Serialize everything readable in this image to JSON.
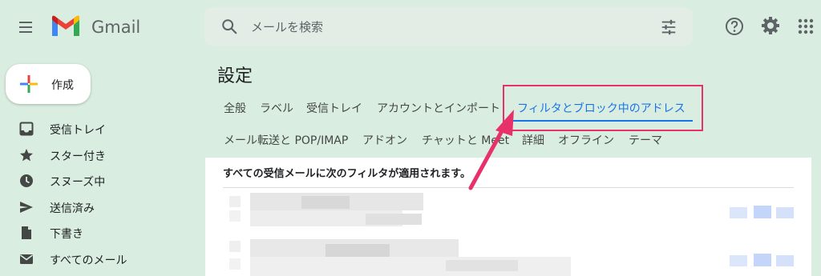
{
  "app": {
    "name": "Gmail"
  },
  "search": {
    "placeholder": "メールを検索"
  },
  "compose": {
    "label": "作成"
  },
  "sidebar": {
    "items": [
      {
        "label": "受信トレイ",
        "icon": "inbox-icon"
      },
      {
        "label": "スター付き",
        "icon": "star-icon"
      },
      {
        "label": "スヌーズ中",
        "icon": "clock-icon"
      },
      {
        "label": "送信済み",
        "icon": "send-icon"
      },
      {
        "label": "下書き",
        "icon": "draft-icon"
      },
      {
        "label": "すべてのメール",
        "icon": "mail-icon"
      }
    ]
  },
  "settings": {
    "title": "設定",
    "tabs_row1": [
      "全般",
      "ラベル",
      "受信トレイ",
      "アカウントとインポート",
      "フィルタとブロック中のアドレス"
    ],
    "tabs_row2": [
      "メール転送と POP/IMAP",
      "アドオン",
      "チャットと Meet",
      "詳細",
      "オフライン",
      "テーマ"
    ],
    "active_tab": "フィルタとブロック中のアドレス"
  },
  "filters": {
    "heading": "すべての受信メールに次のフィルタが適用されます。"
  },
  "colors": {
    "background": "#d9eee0",
    "accent": "#1a73e8",
    "annotation": "#e8316a"
  }
}
